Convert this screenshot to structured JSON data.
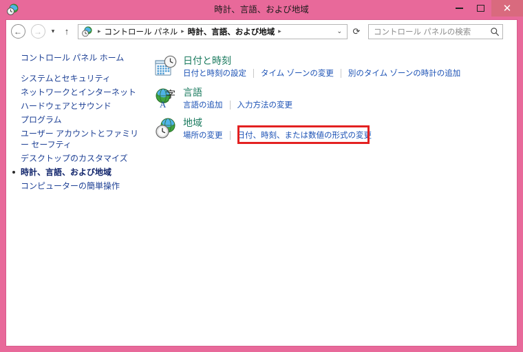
{
  "window": {
    "title": "時計、言語、および地域",
    "icon": "clock-globe-icon",
    "accent_color": "#e8699a",
    "close_button_color": "#d96a7e",
    "buttons": {
      "minimize": "－",
      "maximize": "□",
      "close": "✕"
    }
  },
  "toolbar": {
    "back": "back-arrow",
    "forward": "forward-arrow",
    "recent_caret": "▾",
    "up": "↑",
    "breadcrumb": {
      "icon": "clock-globe-icon",
      "separator": "▸",
      "items": [
        {
          "label": "コントロール パネル",
          "bold": false
        },
        {
          "label": "時計、言語、および地域",
          "bold": true
        }
      ],
      "trailing_separator": "▸",
      "caret": "⌄"
    },
    "refresh": "⟳",
    "search": {
      "placeholder": "コントロール パネルの検索",
      "icon": "search-icon"
    }
  },
  "sidebar": {
    "home_label": "コントロール パネル ホーム",
    "items": [
      {
        "label": "システムとセキュリティ",
        "selected": false
      },
      {
        "label": "ネットワークとインターネット",
        "selected": false
      },
      {
        "label": "ハードウェアとサウンド",
        "selected": false
      },
      {
        "label": "プログラム",
        "selected": false
      },
      {
        "label": "ユーザー アカウントとファミリー セーフティ",
        "selected": false
      },
      {
        "label": "デスクトップのカスタマイズ",
        "selected": false
      },
      {
        "label": "時計、言語、および地域",
        "selected": true
      },
      {
        "label": "コンピューターの簡単操作",
        "selected": false
      }
    ]
  },
  "main": {
    "heading_color": "#1a7a5e",
    "link_color": "#1c52b5",
    "categories": [
      {
        "icon": "calendar-clock-icon",
        "title": "日付と時刻",
        "links": [
          "日付と時刻の設定",
          "タイム ゾーンの変更",
          "別のタイム ゾーンの時計の追加"
        ]
      },
      {
        "icon": "globe-language-icon",
        "title": "言語",
        "links": [
          "言語の追加",
          "入力方法の変更"
        ]
      },
      {
        "icon": "globe-clock-icon",
        "title": "地域",
        "links": [
          "場所の変更",
          "日付、時刻、または数値の形式の変更"
        ]
      }
    ]
  },
  "annotation": {
    "highlight_color": "#e32020",
    "target_label": "日付、時刻、または数値の形式の変更"
  }
}
